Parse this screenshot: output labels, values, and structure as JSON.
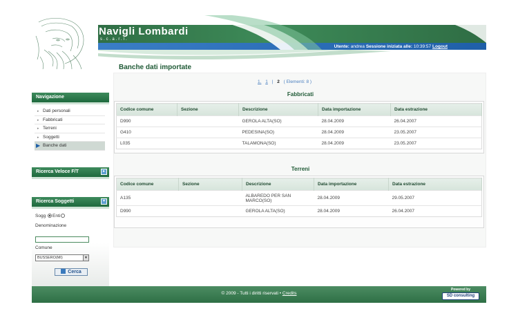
{
  "header": {
    "title": "Navigli Lombardi",
    "subtitle": "s.c.a.r.l.",
    "user_label": "Utente:",
    "user_name": "andrea",
    "session_label": "Sessione iniziata alle:",
    "session_time": "10:39:57",
    "logout_label": "Logout"
  },
  "sidebar": {
    "nav_title": "Navigazione",
    "items": [
      {
        "label": "Dati personali"
      },
      {
        "label": "Fabbricati"
      },
      {
        "label": "Terreni"
      },
      {
        "label": "Soggetti"
      },
      {
        "label": "Banche dati"
      }
    ],
    "ricerca_veloce_title": "Ricerca Veloce F/T",
    "ricerca_soggetti_title": "Ricerca Soggetti",
    "search": {
      "sogg_label": "Sogg",
      "enti_label": "Enti",
      "denominazione_label": "Denominazione",
      "denominazione_value": "",
      "comune_label": "Comune",
      "comune_value": "BUSSERO(MI)",
      "cerca_label": "Cerca"
    }
  },
  "main": {
    "title": "Banche dati importate",
    "pager": {
      "prefix": "1.",
      "page1": "1",
      "separator": "|",
      "page2": "2",
      "elements": "( Elementi: 8 )"
    },
    "fabbricati": {
      "title": "Fabbricati",
      "headers": [
        "Codice comune",
        "Sezione",
        "Descrizione",
        "Data importazione",
        "Data estrazione"
      ],
      "rows": [
        [
          "D990",
          "",
          "GEROLA ALTA(SO)",
          "28.04.2009",
          "26.04.2007"
        ],
        [
          "G410",
          "",
          "PEDESINA(SO)",
          "28.04.2009",
          "23.05.2007"
        ],
        [
          "L035",
          "",
          "TALAMONA(SO)",
          "28.04.2009",
          "23.05.2007"
        ]
      ]
    },
    "terreni": {
      "title": "Terreni",
      "headers": [
        "Codice comune",
        "Sezione",
        "Descrizione",
        "Data importazione",
        "Data estrazione"
      ],
      "rows": [
        [
          "A135",
          "",
          "ALBAREDO PER SAN MARCO(SO)",
          "28.04.2009",
          "29.05.2007"
        ],
        [
          "D990",
          "",
          "GEROLA ALTA(SO)",
          "28.04.2009",
          "26.04.2007"
        ]
      ]
    }
  },
  "footer": {
    "copyright": "© 2009 - Tutti i diritti riservati •",
    "credits": "Credits",
    "powered_by": "Powered by",
    "brand": "SD consulting"
  },
  "colors": {
    "brand_green": "#2e6f45",
    "header_blue": "#1f5fa8",
    "title_green": "#1f5a36"
  }
}
